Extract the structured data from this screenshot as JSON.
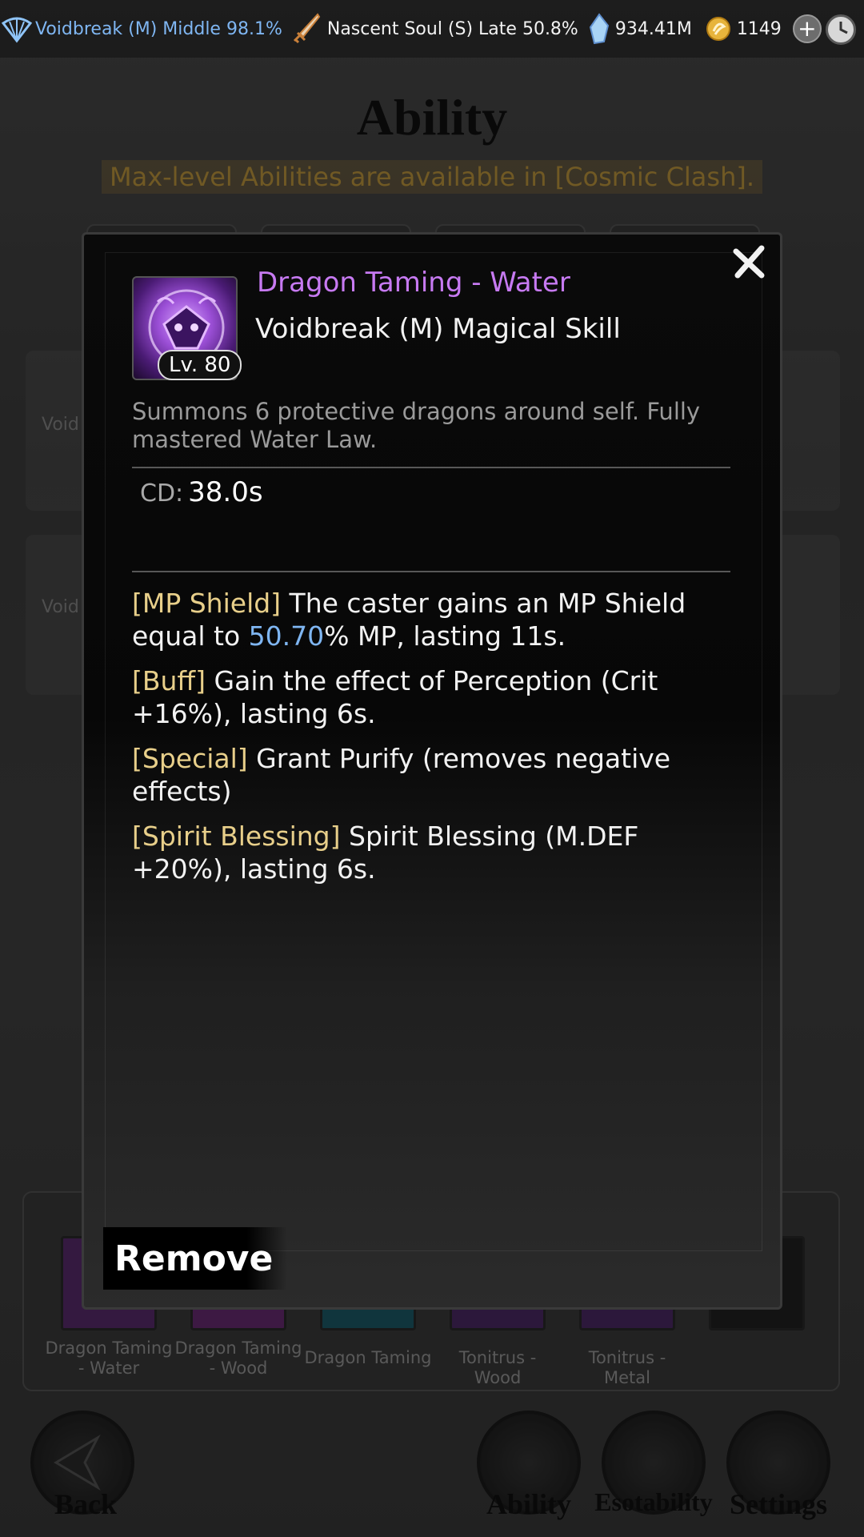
{
  "topbar": {
    "realm_primary": "Voidbreak (M) Middle 98.1%",
    "realm_secondary": "Nascent Soul (S) Late 50.8%",
    "spirit_stones": "934.41M",
    "gold": "1149",
    "plus": "+"
  },
  "page": {
    "title": "Ability",
    "subtitle": "Max-level Abilities are available in [Cosmic Clash]."
  },
  "background_cards": {
    "card1_label": "Void\n(",
    "card2_label": "Void\n("
  },
  "skill_list": [
    {
      "label": "Dragon Taming - Water"
    },
    {
      "label": "Dragon Taming - Wood"
    },
    {
      "label": "Dragon Taming"
    },
    {
      "label": "Tonitrus - Wood"
    },
    {
      "label": "Tonitrus - Metal"
    }
  ],
  "bottom_nav": {
    "back": "Back",
    "ability": "Ability",
    "esotability": "Esotability",
    "settings": "Settings"
  },
  "modal": {
    "skill_name": "Dragon Taming - Water",
    "skill_type": "Voidbreak (M) Magical Skill",
    "level": "Lv. 80",
    "description": "Summons 6 protective dragons around self. Fully mastered Water Law.",
    "cd_label": "CD:",
    "cd_value": "38.0s",
    "effects": [
      {
        "tag": "[MP Shield]",
        "pre": " The caster gains an MP Shield equal to ",
        "highlight": "50.70",
        "post": "% MP, lasting 11s."
      },
      {
        "tag": "[Buff]",
        "pre": " Gain the effect of Perception (Crit +16%), lasting 6s.",
        "highlight": "",
        "post": ""
      },
      {
        "tag": "[Special]",
        "pre": " Grant Purify (removes negative effects)",
        "highlight": "",
        "post": ""
      },
      {
        "tag": "[Spirit Blessing]",
        "pre": " Spirit Blessing (M.DEF +20%), lasting 6s.",
        "highlight": "",
        "post": ""
      }
    ],
    "remove_label": "Remove"
  },
  "colors": {
    "skill_name": "#c77af2",
    "tag": "#e8cf8a",
    "highlight": "#7fb6f2",
    "realm_primary": "#7fb6f2"
  }
}
